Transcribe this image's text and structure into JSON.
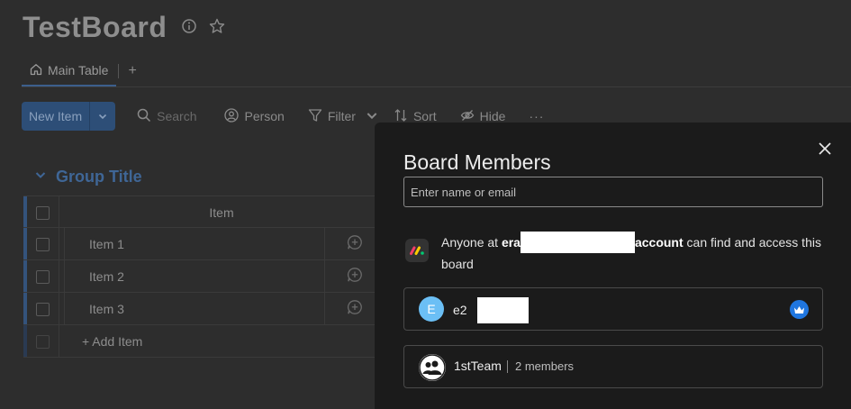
{
  "board": {
    "title": "TestBoard",
    "tabs": [
      {
        "label": "Main Table"
      }
    ],
    "add_tab_label": "+",
    "toolbar": {
      "new_item": "New Item",
      "search_placeholder": "Search",
      "person": "Person",
      "filter": "Filter",
      "sort": "Sort",
      "hide": "Hide",
      "more": "···"
    },
    "group": {
      "title": "Group Title",
      "column_header": "Item",
      "items": [
        "Item 1",
        "Item 2",
        "Item 3"
      ],
      "add_item": "+ Add Item"
    }
  },
  "modal": {
    "title": "Board Members",
    "input_placeholder": "Enter name or email",
    "access": {
      "prefix": "Anyone at ",
      "account_start": "era",
      "account_end": "account",
      "suffix": " can find and access this board"
    },
    "members": [
      {
        "initial": "E",
        "name_visible": "e2",
        "owner": true
      }
    ],
    "teams": [
      {
        "name": "1stTeam",
        "members": "2 members"
      }
    ]
  },
  "colors": {
    "accent": "#2d4e77",
    "group": "#3f6696",
    "avatar": "#6bbff5",
    "crown": "#1f76e0"
  }
}
